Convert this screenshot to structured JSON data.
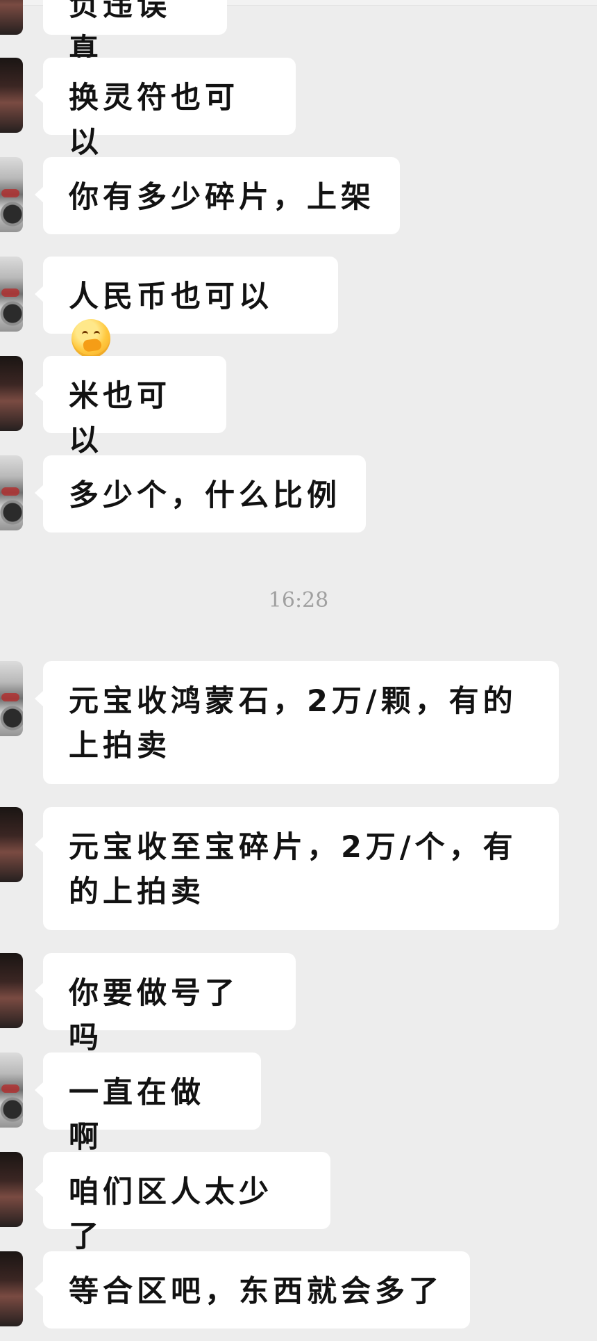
{
  "messages": [
    {
      "text": "负违误真",
      "avatar": "dark-portrait"
    },
    {
      "text": "换灵符也可以",
      "avatar": "dark-portrait"
    },
    {
      "text": "你有多少碎片，上架",
      "avatar": "motorcycle-photo"
    },
    {
      "text": "人民币也可以",
      "avatar": "motorcycle-photo",
      "emoji": "thinking-face-icon"
    },
    {
      "text": "米也可以",
      "avatar": "dark-portrait"
    },
    {
      "text": "多少个，什么比例",
      "avatar": "motorcycle-photo"
    },
    {
      "text": "元宝收鸿蒙石，2万/颗，有的上拍卖",
      "avatar": "motorcycle-photo"
    },
    {
      "text": "元宝收至宝碎片，2万/个，有的上拍卖",
      "avatar": "dark-portrait"
    },
    {
      "text": "你要做号了吗",
      "avatar": "dark-portrait"
    },
    {
      "text": "一直在做啊",
      "avatar": "motorcycle-photo"
    },
    {
      "text": "咱们区人太少了",
      "avatar": "dark-portrait"
    },
    {
      "text": "等合区吧，东西就会多了",
      "avatar": "dark-portrait"
    }
  ],
  "timestamp": "16:28",
  "colors": {
    "background": "#ededed",
    "bubble": "#ffffff",
    "text": "#121212",
    "timestamp": "#a0a0a0"
  }
}
